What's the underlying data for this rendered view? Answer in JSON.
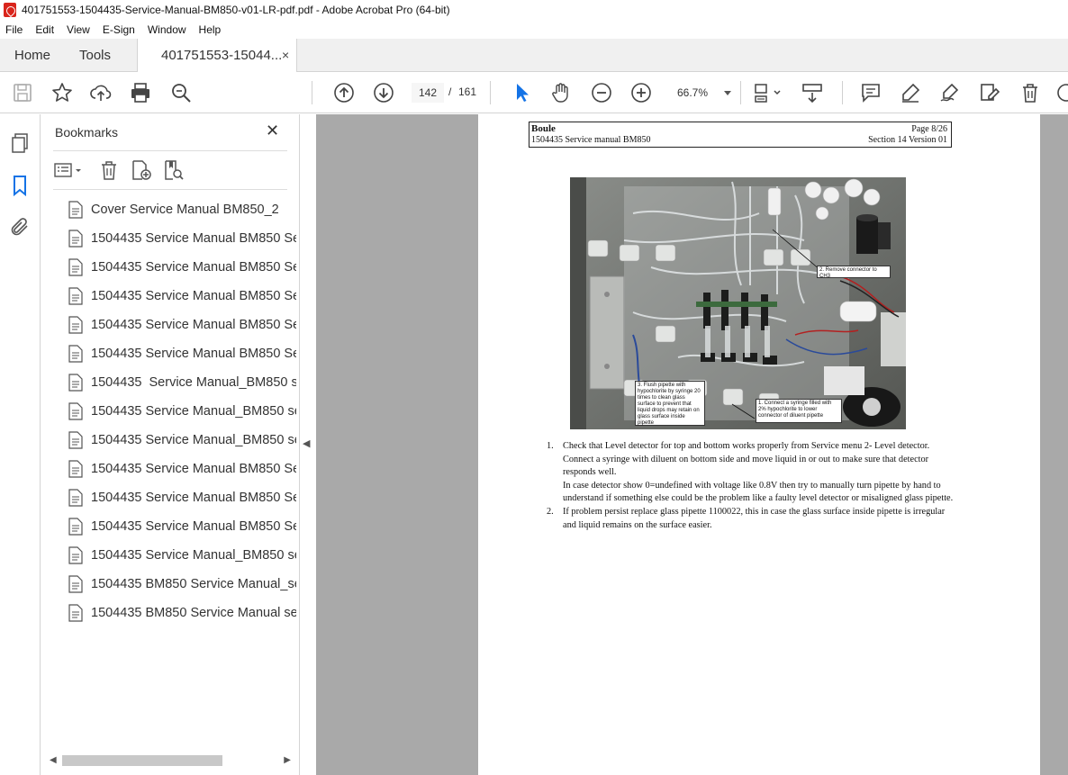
{
  "window": {
    "title": "401751553-1504435-Service-Manual-BM850-v01-LR-pdf.pdf - Adobe Acrobat Pro (64-bit)"
  },
  "menu": {
    "items": [
      "File",
      "Edit",
      "View",
      "E-Sign",
      "Window",
      "Help"
    ]
  },
  "tabs": {
    "home": "Home",
    "tools": "Tools",
    "document": "401751553-15044...",
    "close_symbol": "×"
  },
  "toolbar": {
    "page_current": "142",
    "page_separator": "/",
    "page_total": "161",
    "zoom": "66.7%",
    "icons": [
      "save-icon",
      "bookmark-star-icon",
      "upload-icon",
      "print-icon",
      "zoom-search-icon",
      "page-up-icon",
      "page-down-icon",
      "select-arrow-icon",
      "hand-icon",
      "zoom-out-icon",
      "zoom-in-icon",
      "fit-page-icon",
      "scroll-mode-icon",
      "comment-icon",
      "highlight-icon",
      "sign-icon",
      "edit-pdf-icon",
      "delete-icon"
    ]
  },
  "bookmarks": {
    "title": "Bookmarks",
    "close_symbol": "✕",
    "items": [
      "Cover Service Manual BM850_2",
      "1504435 Service Manual BM850 Se",
      "1504435 Service Manual BM850 Se",
      "1504435 Service Manual BM850 Se",
      "1504435 Service Manual BM850 Se",
      "1504435 Service Manual BM850 Se",
      "1504435  Service Manual_BM850 s",
      "1504435 Service Manual_BM850 se",
      "1504435 Service Manual_BM850 se",
      "1504435 Service Manual BM850 Se",
      "1504435 Service Manual BM850 Se",
      "1504435 Service Manual BM850 Se",
      "1504435 Service Manual_BM850 se",
      "1504435 BM850 Service Manual_se",
      "1504435 BM850 Service Manual se"
    ]
  },
  "document": {
    "header": {
      "company": "Boule",
      "manual": "1504435 Service manual BM850",
      "page": "Page 8/26",
      "section": "Section 14 Version 01"
    },
    "callouts": {
      "remove_connector": "2. Remove connector to CH3",
      "flush_pipette": "3. Flush pipette with hypochlorite by syringe 20 times to clean glass surface to prevent that liquid drops may retain on glass surface inside pipette",
      "connect_syringe": "1. Connect a syringe filled with 2% hypochlorite to lower connector of diluent pipette"
    },
    "steps": [
      {
        "num": "1.",
        "text": "Check that Level detector for top and bottom works properly from Service menu 2- Level detector. Connect a syringe with diluent on bottom side and move liquid in or out to make sure that detector responds well.",
        "extra": "In case detector show 0=undefined with voltage like 0.8V then try to manually turn pipette by hand to understand if something else could be the problem like a faulty level detector or misaligned glass pipette."
      },
      {
        "num": "2.",
        "text": "If problem persist replace glass pipette 1100022, this in case the glass surface inside pipette is irregular and liquid remains on the surface easier.",
        "extra": ""
      }
    ]
  },
  "colors": {
    "acrobat_red": "#d9251c",
    "doc_background": "#a9a9a9",
    "select_blue": "#1473e6"
  }
}
